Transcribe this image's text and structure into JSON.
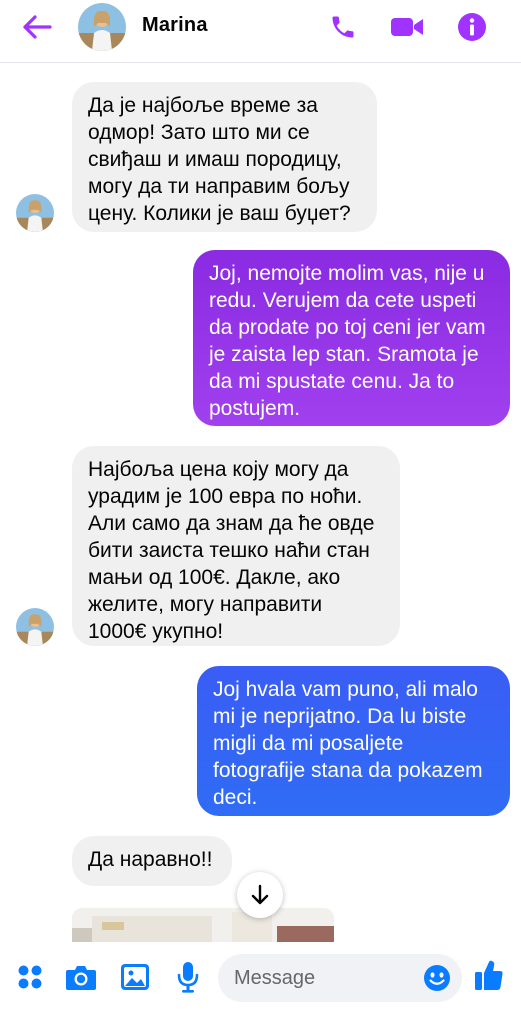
{
  "header": {
    "contact_name": "Marina"
  },
  "messages": [
    {
      "direction": "incoming",
      "text": "Да је најбоље време за одмор! Зато што ми се свиђаш и имаш породицу, могу да ти направим бољу цену. Колики је ваш буџет?"
    },
    {
      "direction": "outgoing",
      "text": "Joj, nemojte molim vas, nije u redu. Verujem da cete uspeti da prodate po toj ceni jer vam je zaista lep stan. Sramota je da mi spustate cenu. Ja to postujem."
    },
    {
      "direction": "incoming",
      "text": "Најбоља цена коју могу да урадим је 100 евра по ноћи. Али само да знам да ће овде бити заиста тешко наћи стан мањи од 100€. Дакле, ако желите, могу направити 1000€ укупно!"
    },
    {
      "direction": "outgoing",
      "text": "Joj hvala vam puno, ali malo mi je neprijatno. Da lu biste migli da mi posaljete fotografije stana da pokazem deci."
    },
    {
      "direction": "incoming",
      "text": "Да наравно!!"
    }
  ],
  "composer": {
    "placeholder": "Message"
  },
  "icons": {
    "back": "arrow-left-icon",
    "call": "phone-icon",
    "video": "video-camera-icon",
    "info": "info-icon",
    "menu": "four-dots-icon",
    "camera": "camera-icon",
    "gallery": "image-icon",
    "mic": "microphone-icon",
    "emoji": "smiley-icon",
    "like": "thumbs-up-icon",
    "scroll": "arrow-down-icon"
  },
  "colors": {
    "accent": "#a033ff",
    "accent_blue": "#0a7cff",
    "incoming_bubble": "#f0f0f0",
    "outgoing_1_top": "#8a2be2",
    "outgoing_1_bottom": "#a040ee",
    "outgoing_2_top": "#3a5df5",
    "outgoing_2_bottom": "#2f6cf5"
  }
}
